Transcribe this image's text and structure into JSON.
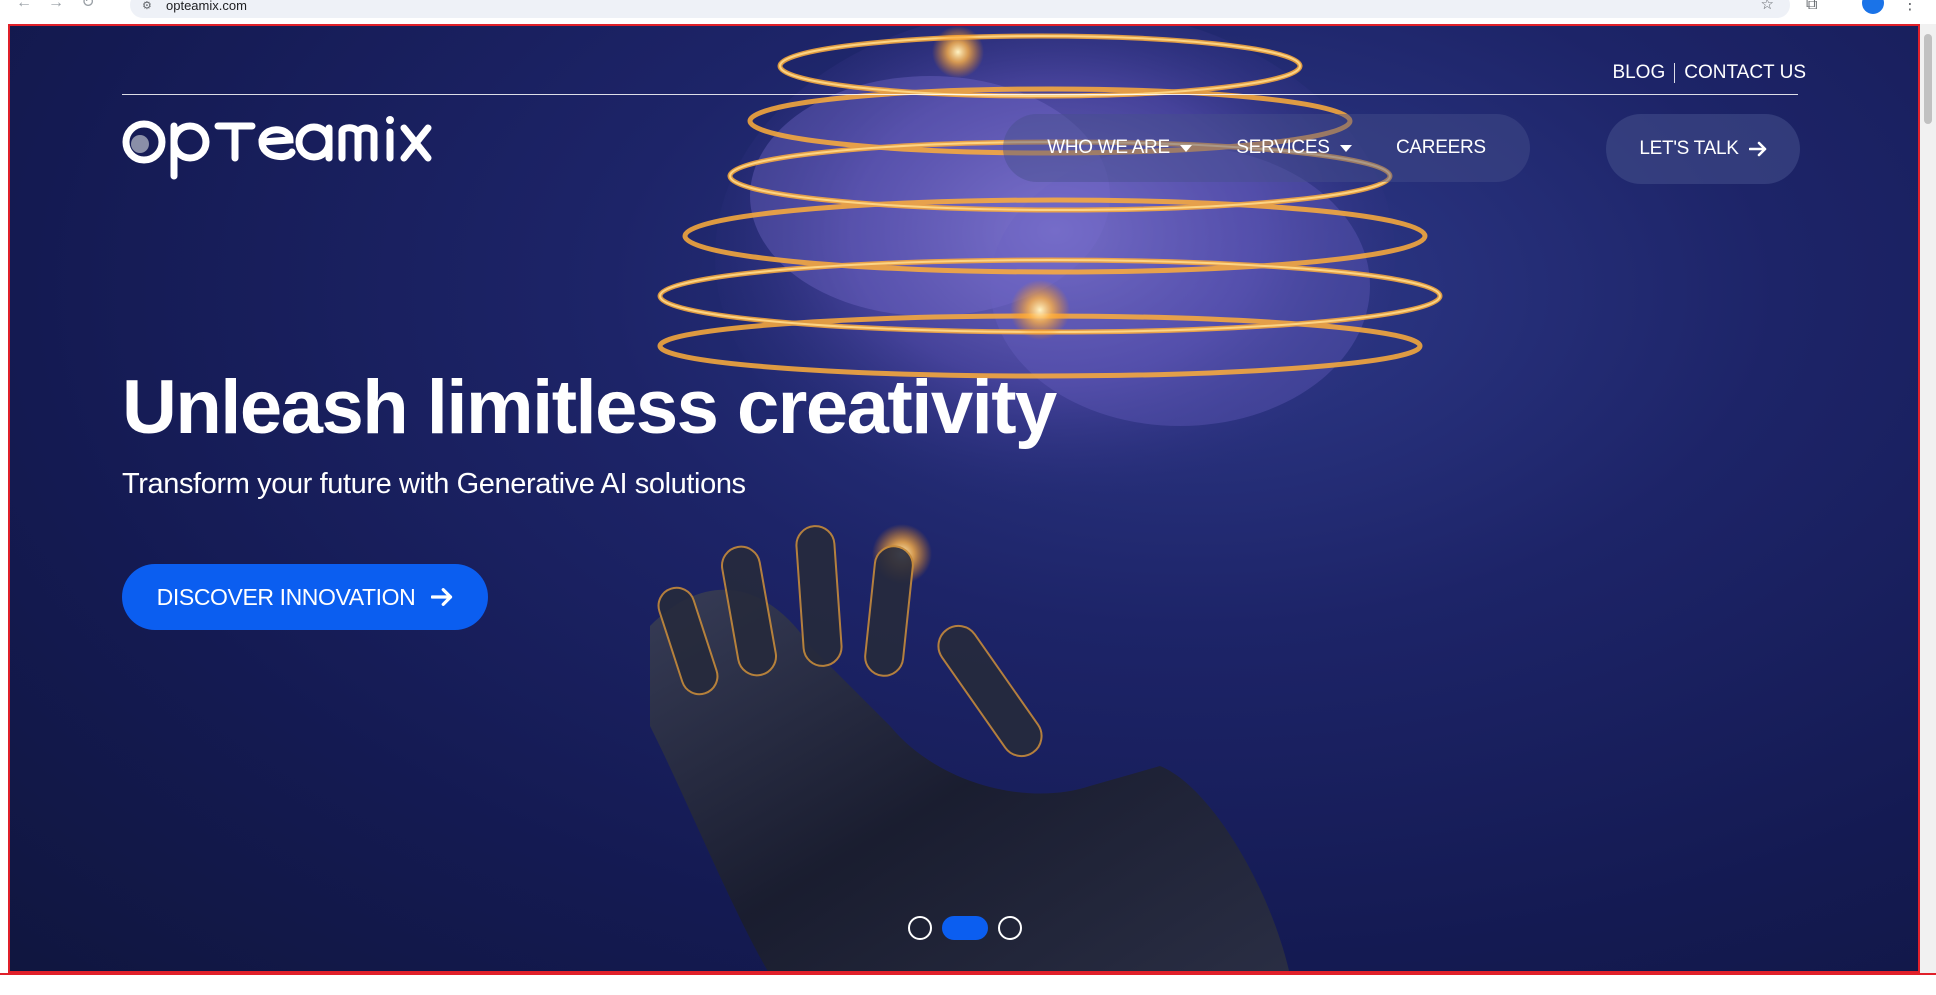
{
  "browser": {
    "url": "opteamix.com"
  },
  "header": {
    "top_links": [
      "BLOG",
      "CONTACT US"
    ],
    "logo_text": "opteamix",
    "nav": [
      {
        "label": "WHO WE ARE",
        "has_dropdown": true
      },
      {
        "label": "SERVICES",
        "has_dropdown": true
      },
      {
        "label": "CAREERS",
        "has_dropdown": false
      }
    ],
    "cta_label": "LET'S TALK"
  },
  "hero": {
    "headline": "Unleash limitless creativity",
    "subheadline": "Transform your future with Generative AI solutions",
    "button_label": "DISCOVER INNOVATION",
    "slides_total": 3,
    "active_slide": 2
  },
  "icons": {
    "back": "back-arrow-icon",
    "forward": "forward-arrow-icon",
    "reload": "reload-icon",
    "site_info": "site-info-icon",
    "bookmark": "star-icon",
    "extensions": "extensions-icon",
    "profile": "profile-avatar-icon",
    "menu": "kebab-menu-icon",
    "dropdown": "chevron-down-icon",
    "arrow": "arrow-right-icon"
  },
  "colors": {
    "primary_blue": "#0b5ef0",
    "hero_background": "#1a2160",
    "text": "#ffffff"
  }
}
